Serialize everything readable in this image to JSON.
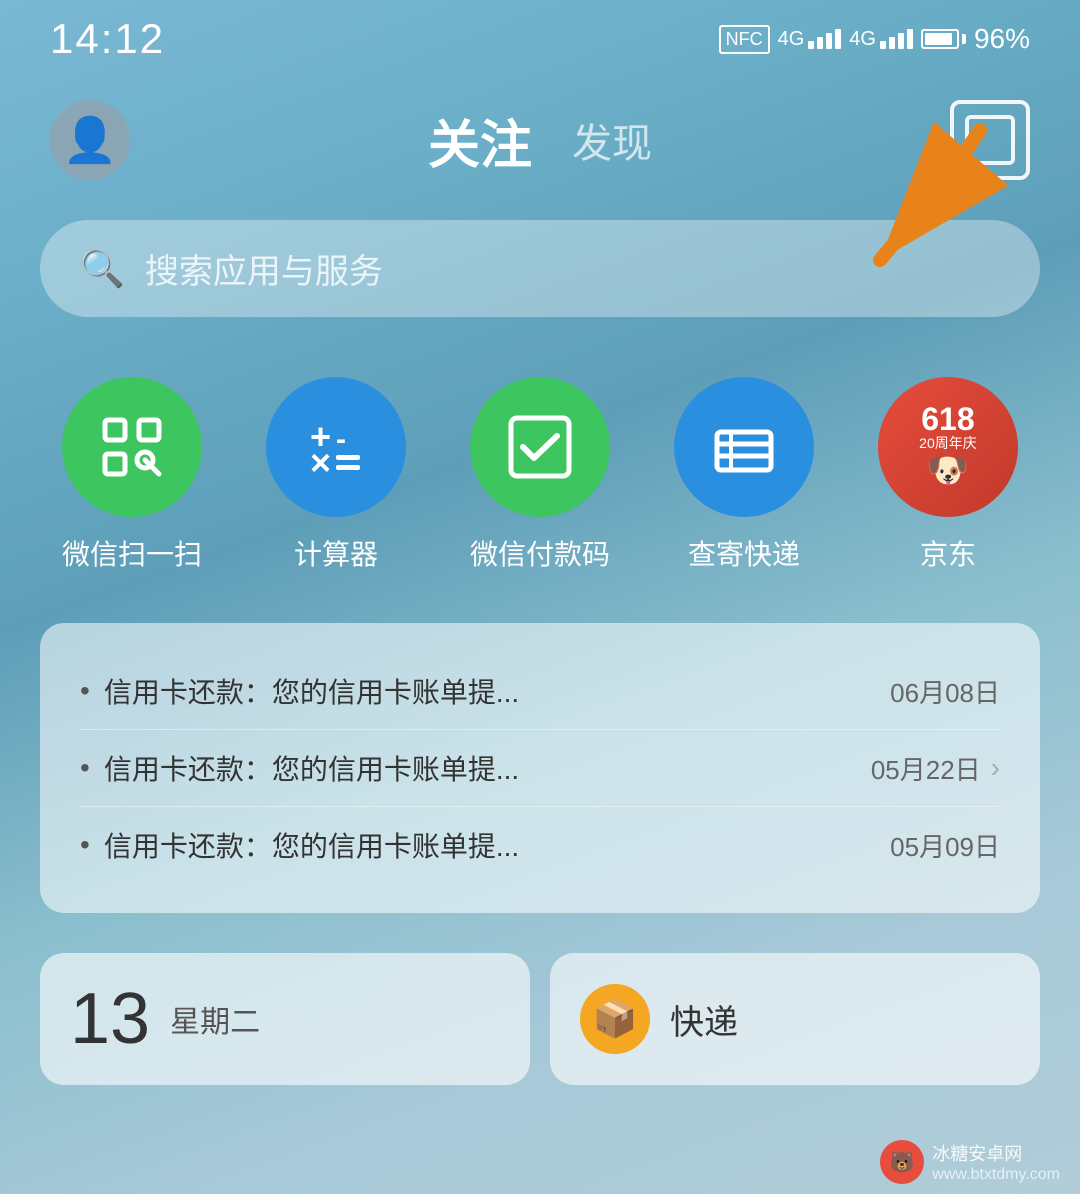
{
  "statusBar": {
    "time": "14:12",
    "battery": "96%"
  },
  "header": {
    "tabActive": "关注",
    "tabInactive": "发现"
  },
  "search": {
    "placeholder": "搜索应用与服务"
  },
  "apps": [
    {
      "id": "wechat-scan",
      "label": "微信扫一扫",
      "color": "green",
      "icon": "scan"
    },
    {
      "id": "calculator",
      "label": "计算器",
      "color": "blue",
      "icon": "calc"
    },
    {
      "id": "wechat-pay",
      "label": "微信付款码",
      "color": "green",
      "icon": "pay"
    },
    {
      "id": "express",
      "label": "查寄快递",
      "color": "blue",
      "icon": "box"
    },
    {
      "id": "jd",
      "label": "京东",
      "color": "red",
      "icon": "jd"
    }
  ],
  "notifications": [
    {
      "text": "信用卡还款：您的信用卡账单提...",
      "date": "06月08日",
      "hasArrow": false
    },
    {
      "text": "信用卡还款：您的信用卡账单提...",
      "date": "05月22日",
      "hasArrow": true
    },
    {
      "text": "信用卡还款：您的信用卡账单提...",
      "date": "05月09日",
      "hasArrow": false
    }
  ],
  "bottomCards": [
    {
      "id": "calendar",
      "date": "13",
      "label": "星期二"
    },
    {
      "id": "delivery",
      "label": "快递"
    }
  ],
  "watermark": {
    "url": "www.btxtdmy.com",
    "name": "冰糖安卓网"
  }
}
